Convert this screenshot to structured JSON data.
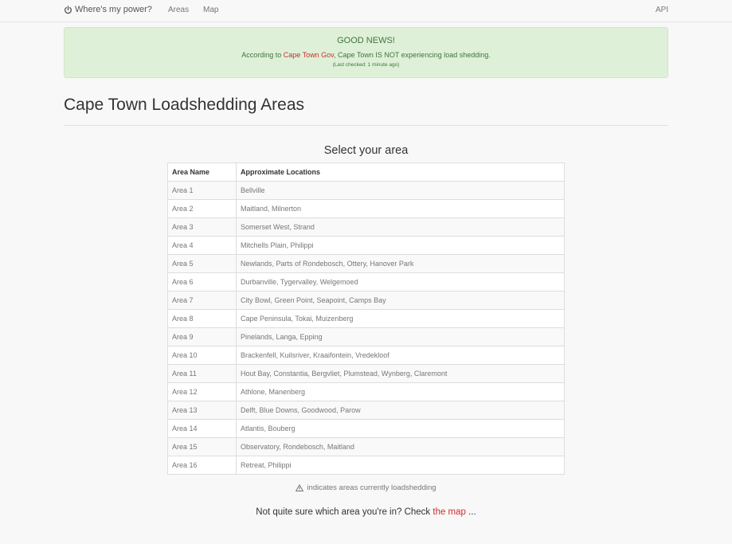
{
  "nav": {
    "brand": "Where's my power?",
    "links": [
      "Areas",
      "Map"
    ],
    "api": "API"
  },
  "alert": {
    "title": "GOOD NEWS!",
    "prefix": "According to ",
    "source_link": "Cape Town Gov",
    "suffix": ", Cape Town IS NOT experiencing load shedding.",
    "last_checked": "(Last checked: 1 minute ago)"
  },
  "page": {
    "title": "Cape Town Loadshedding Areas",
    "select_heading": "Select your area"
  },
  "table": {
    "headers": [
      "Area Name",
      "Approximate Locations"
    ],
    "rows": [
      [
        "Area 1",
        "Bellville"
      ],
      [
        "Area 2",
        "Maitland, Milnerton"
      ],
      [
        "Area 3",
        "Somerset West, Strand"
      ],
      [
        "Area 4",
        "Mitchells Plain, Philippi"
      ],
      [
        "Area 5",
        "Newlands, Parts of Rondebosch, Ottery, Hanover Park"
      ],
      [
        "Area 6",
        "Durbanville, Tygervalley, Welgemoed"
      ],
      [
        "Area 7",
        "City Bowl, Green Point, Seapoint, Camps Bay"
      ],
      [
        "Area 8",
        "Cape Peninsula, Tokai, Muizenberg"
      ],
      [
        "Area 9",
        "Pinelands, Langa, Epping"
      ],
      [
        "Area 10",
        "Brackenfell, Kuilsriver, Kraaifontein, Vredekloof"
      ],
      [
        "Area 11",
        "Hout Bay, Constantia, Bergvliet, Plumstead, Wynberg, Claremont"
      ],
      [
        "Area 12",
        "Athlone, Manenberg"
      ],
      [
        "Area 13",
        "Delft, Blue Downs, Goodwood, Parow"
      ],
      [
        "Area 14",
        "Atlantis, Bouberg"
      ],
      [
        "Area 15",
        "Observatory, Rondebosch, Maitland"
      ],
      [
        "Area 16",
        "Retreat, Philippi"
      ]
    ]
  },
  "legend": {
    "icon": "warning-icon",
    "text": "indicates areas currently loadshedding"
  },
  "footer": {
    "prefix": "Not quite sure which area you're in? Check ",
    "link": "the map",
    "suffix": " ..."
  },
  "colors": {
    "alert_bg": "#dff0d8",
    "alert_text": "#3c763d",
    "link_red": "#c9302c"
  }
}
